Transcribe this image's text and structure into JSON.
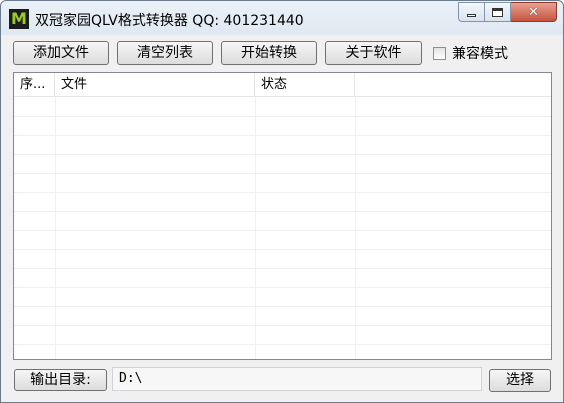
{
  "window": {
    "title": "双冠家园QLV格式转换器 QQ: 401231440",
    "icon": "M",
    "icon_name": "app-m-icon",
    "controls": {
      "minimize": "minimize-icon",
      "maximize": "maximize-icon",
      "close": "✕"
    }
  },
  "toolbar": {
    "add_file": "添加文件",
    "clear_list": "清空列表",
    "start_convert": "开始转换",
    "about": "关于软件",
    "compat_mode_label": "兼容模式",
    "compat_mode_checked": false
  },
  "file_list": {
    "columns": [
      "序...",
      "文件",
      "状态",
      ""
    ],
    "rows": []
  },
  "footer": {
    "output_dir_label": "输出目录:",
    "output_dir_value": "D:\\",
    "choose_button": "选择"
  },
  "colors": {
    "window_bg": "#f0f0f0",
    "titlebar": "#dfe8f1",
    "close_button": "#c45440",
    "icon_fg": "#9ccc2a"
  }
}
